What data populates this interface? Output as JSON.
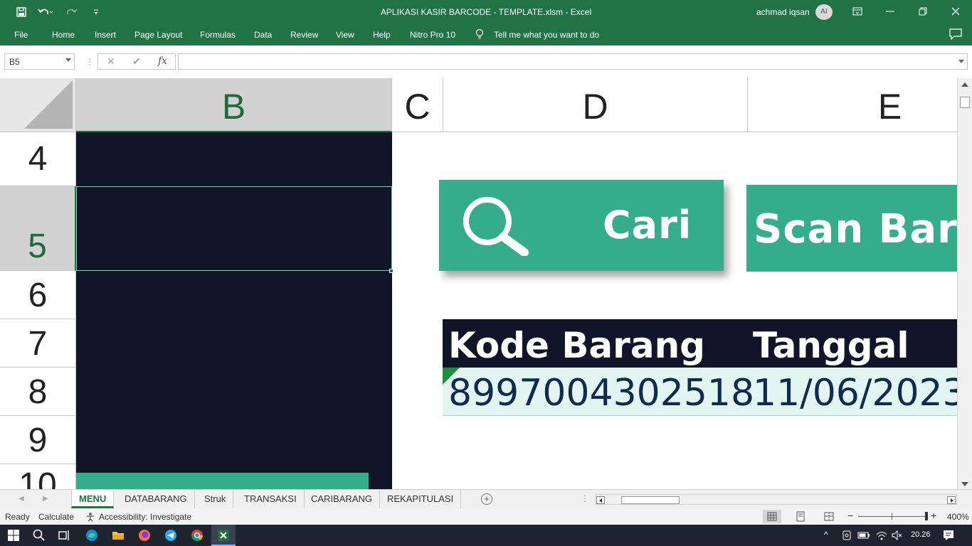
{
  "window": {
    "title": "APLIKASI KASIR BARCODE - TEMPLATE.xlsm  -  Excel",
    "user_name": "achmad iqsan",
    "user_initials": "AI"
  },
  "ribbon": {
    "tabs": [
      "File",
      "Home",
      "Insert",
      "Page Layout",
      "Formulas",
      "Data",
      "Review",
      "View",
      "Help",
      "Nitro Pro 10"
    ],
    "tell_me": "Tell me what you want to do"
  },
  "formula_bar": {
    "name_box": "B5",
    "fx_label": "fx",
    "formula": ""
  },
  "grid": {
    "columns": [
      "B",
      "C",
      "D",
      "E"
    ],
    "rows": [
      "4",
      "5",
      "6",
      "7",
      "8",
      "9",
      "10"
    ],
    "active_cell": "B5"
  },
  "buttons": {
    "cari": "Cari",
    "scan": "Scan Barang"
  },
  "table": {
    "headers": [
      "Kode Barang",
      "Tanggal"
    ],
    "row": [
      "8997004302518",
      "11/06/2023"
    ]
  },
  "sheets": {
    "tabs": [
      "MENU",
      "DATABARANG",
      "Struk",
      "TRANSAKSI",
      "CARIBARANG",
      "REKAPITULASI"
    ],
    "active": "MENU"
  },
  "status": {
    "ready": "Ready",
    "calculate": "Calculate",
    "accessibility": "Accessibility: Investigate",
    "zoom": "400%"
  },
  "taskbar": {
    "time": "20.26"
  },
  "colors": {
    "excel_green": "#217346",
    "teal": "#35ad8b",
    "navy": "#111528",
    "row_fill": "#e2f5f0"
  }
}
